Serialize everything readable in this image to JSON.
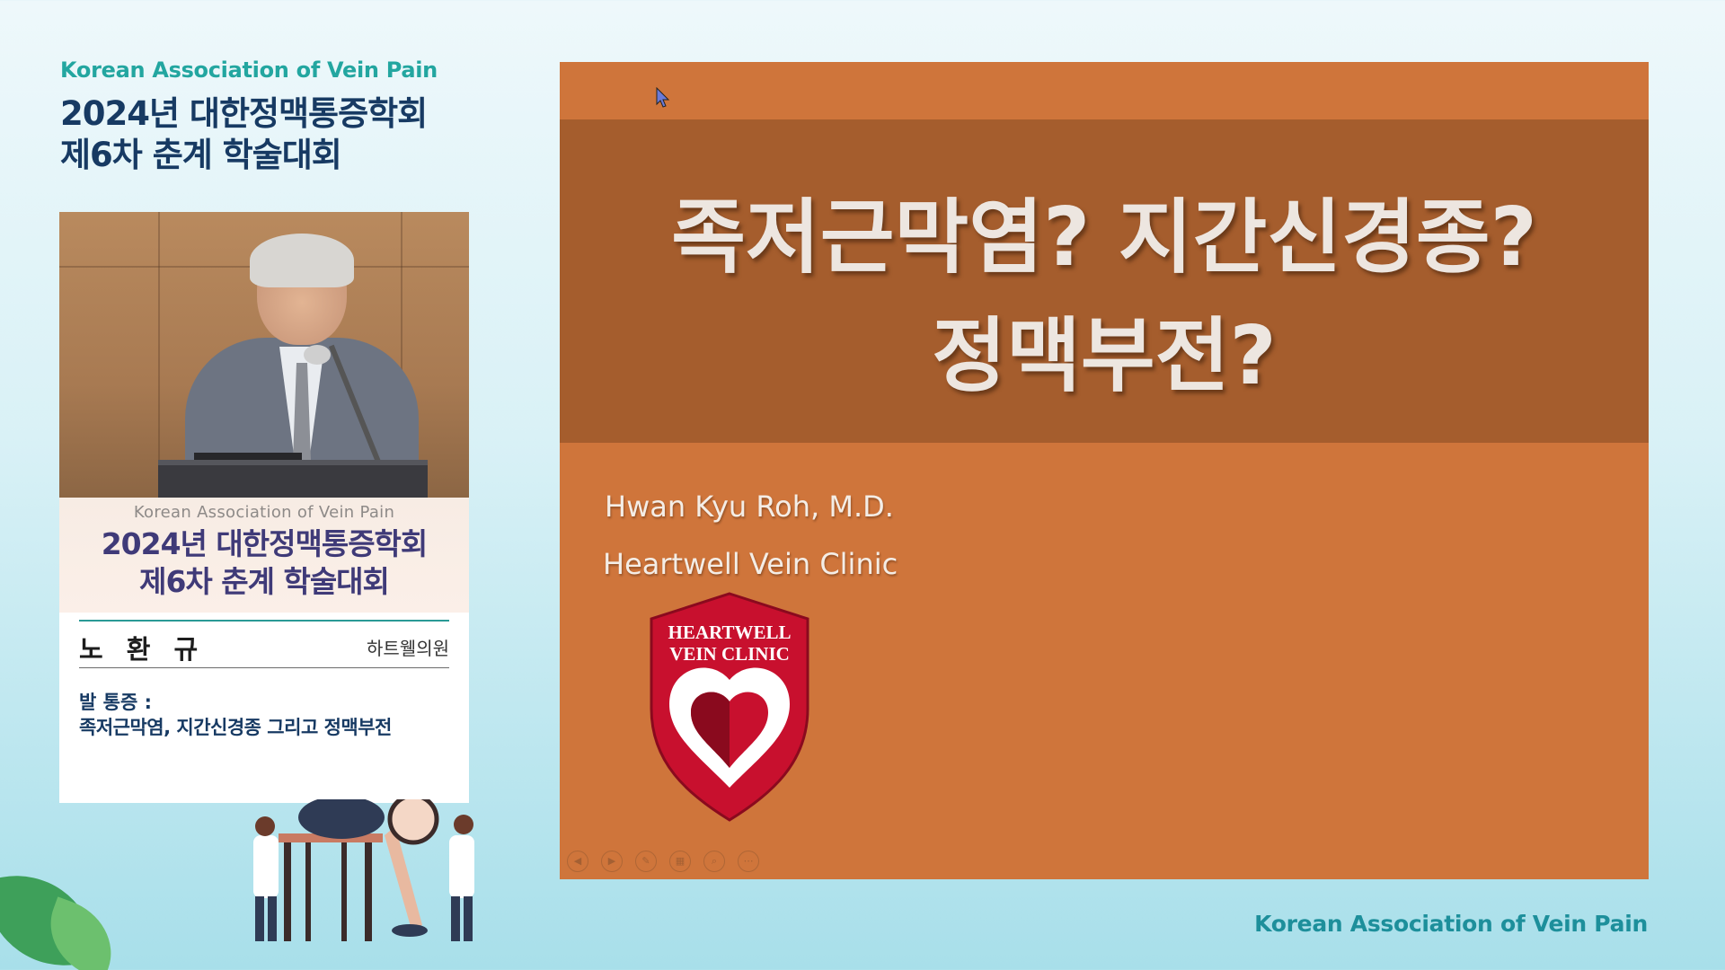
{
  "header": {
    "org": "Korean Association of Vein Pain",
    "title_line1": "2024년 대한정맥통증학회",
    "title_line2": "제6차 춘계 학술대회"
  },
  "speaker_card": {
    "org": "Korean Association of Vein Pain",
    "title_line1": "2024년 대한정맥통증학회",
    "title_line2": "제6차 춘계 학술대회",
    "name": "노 환 규",
    "affiliation": "하트웰의원",
    "topic_label": "발 통증 :",
    "topic": "족저근막염, 지간신경종 그리고 정맥부전"
  },
  "slide": {
    "title_line1": "족저근막염? 지간신경종?",
    "title_line2": "정맥부전?",
    "author": "Hwan Kyu Roh, M.D.",
    "clinic": "Heartwell Vein Clinic",
    "logo_text_line1": "HEARTWELL",
    "logo_text_line2": "VEIN CLINIC",
    "controls": [
      "prev-icon",
      "next-icon",
      "pen-icon",
      "slides-icon",
      "zoom-icon",
      "more-icon"
    ]
  },
  "footer": {
    "org": "Korean Association of Vein Pain"
  },
  "colors": {
    "accent_teal": "#23a6a0",
    "title_navy": "#173a63",
    "slide_orange": "#cf753b",
    "slide_band": "#a55d2d",
    "logo_red": "#c8102e"
  }
}
